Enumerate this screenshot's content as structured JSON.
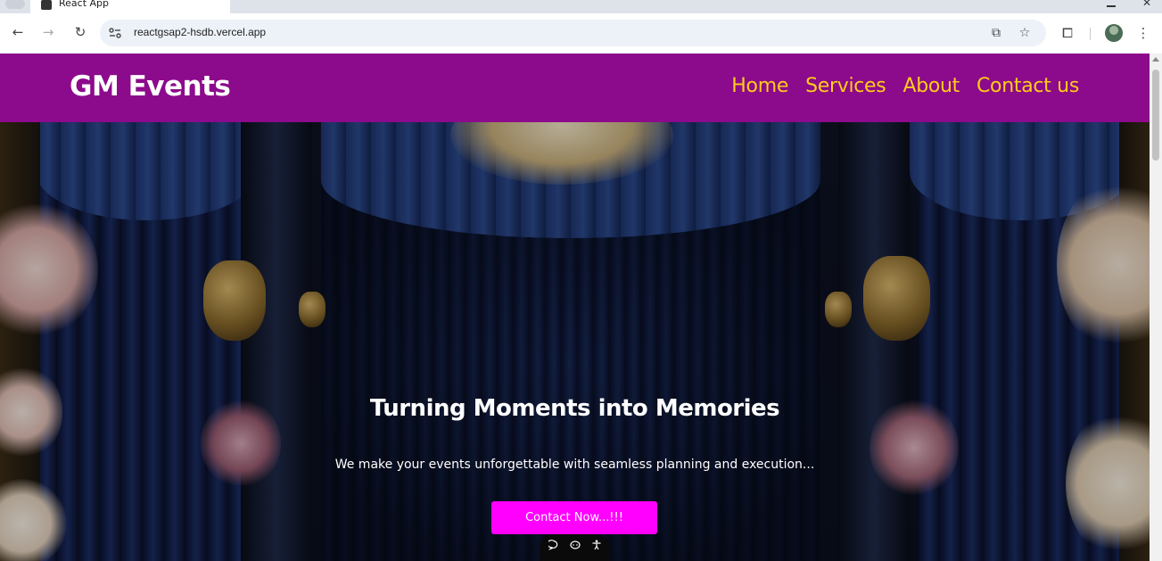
{
  "browser": {
    "tab_title": "React App",
    "url": "reactgsap2-hsdb.vercel.app"
  },
  "site": {
    "logo": "GM Events",
    "nav": [
      "Home",
      "Services",
      "About",
      "Contact us"
    ]
  },
  "hero": {
    "title": "Turning Moments into Memories",
    "subtitle": "We make your events unforgettable with seamless planning and execution...",
    "cta_label": "Contact Now...!!!"
  },
  "colors": {
    "header_bg": "#8c0a8c",
    "nav_text": "#ffcc1a",
    "cta_bg": "#ff00ff"
  }
}
